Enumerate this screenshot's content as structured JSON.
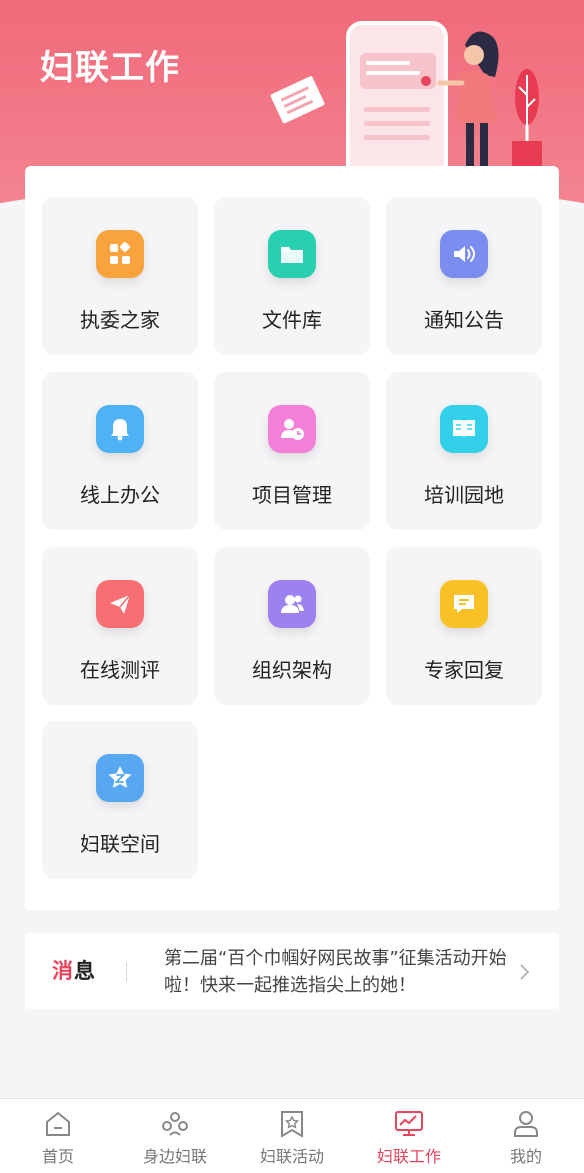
{
  "header": {
    "title": "妇联工作"
  },
  "grid": {
    "items": [
      {
        "label": "执委之家",
        "icon": "apps-icon",
        "color": "#f8a33c"
      },
      {
        "label": "文件库",
        "icon": "folder-icon",
        "color": "#28cfb0"
      },
      {
        "label": "通知公告",
        "icon": "speaker-icon",
        "color": "#7b8ef0"
      },
      {
        "label": "线上办公",
        "icon": "bell-icon",
        "color": "#4fb2f5"
      },
      {
        "label": "项目管理",
        "icon": "user-clock-icon",
        "color": "#f47fd9"
      },
      {
        "label": "培训园地",
        "icon": "book-icon",
        "color": "#33d0ea"
      },
      {
        "label": "在线测评",
        "icon": "paper-plane-icon",
        "color": "#f76f73"
      },
      {
        "label": "组织架构",
        "icon": "users-icon",
        "color": "#9b82f0"
      },
      {
        "label": "专家回复",
        "icon": "message-icon",
        "color": "#f8c126"
      },
      {
        "label": "妇联空间",
        "icon": "star-z-icon",
        "color": "#57a8f0"
      }
    ]
  },
  "message": {
    "tag_part1": "消",
    "tag_part2": "息",
    "text": "第二届“百个巾帼好网民故事”征集活动开始啦！快来一起推选指尖上的她！"
  },
  "tabbar": {
    "items": [
      {
        "label": "首页",
        "icon": "home-icon",
        "active": false
      },
      {
        "label": "身边妇联",
        "icon": "people-icon",
        "active": false
      },
      {
        "label": "妇联活动",
        "icon": "bookmark-star-icon",
        "active": false
      },
      {
        "label": "妇联工作",
        "icon": "monitor-chart-icon",
        "active": true
      },
      {
        "label": "我的",
        "icon": "person-icon",
        "active": false
      }
    ]
  },
  "colors": {
    "accent": "#e8455c",
    "header": "#f06a7a"
  }
}
